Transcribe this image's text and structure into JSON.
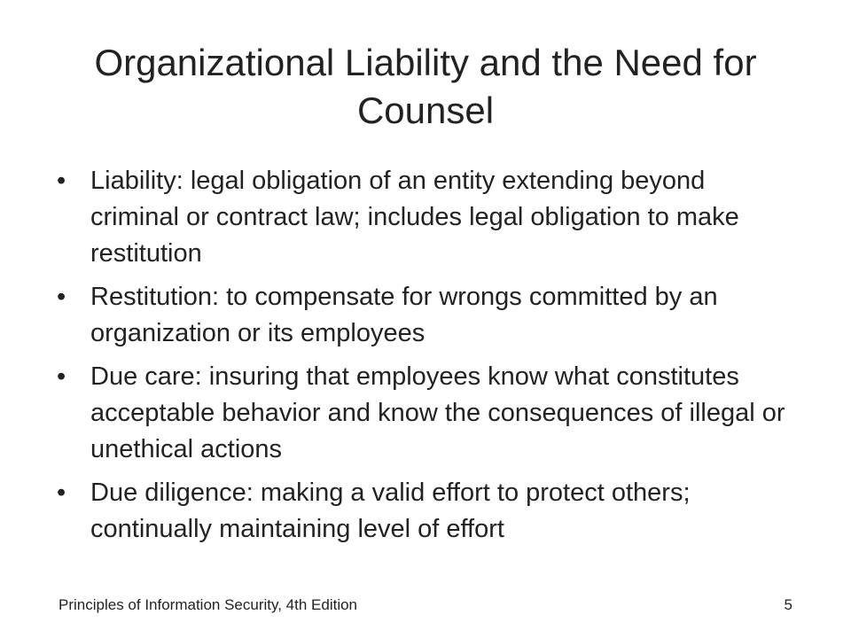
{
  "slide": {
    "title": "Organizational Liability and the Need for Counsel",
    "bullet_glyph": "•",
    "bullets": [
      "Liability: legal obligation of an entity extending beyond criminal or contract law; includes legal obligation to make restitution",
      "Restitution: to compensate for wrongs committed by an organization or its employees",
      "Due care: insuring that employees know what constitutes acceptable behavior and know the consequences of illegal or unethical actions",
      "Due diligence: making a valid effort to protect others; continually maintaining level of effort"
    ]
  },
  "footer": {
    "book_title": "Principles of Information Security, 4th Edition",
    "page_number": "5"
  }
}
